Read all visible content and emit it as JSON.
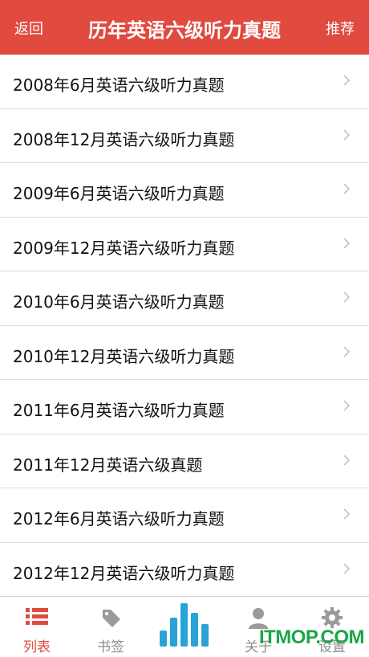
{
  "header": {
    "back_label": "返回",
    "title": "历年英语六级听力真题",
    "recommend_label": "推荐"
  },
  "list": {
    "items": [
      {
        "label": "2008年6月英语六级听力真题"
      },
      {
        "label": "2008年12月英语六级听力真题"
      },
      {
        "label": "2009年6月英语六级听力真题"
      },
      {
        "label": "2009年12月英语六级听力真题"
      },
      {
        "label": "2010年6月英语六级听力真题"
      },
      {
        "label": "2010年12月英语六级听力真题"
      },
      {
        "label": "2011年6月英语六级听力真题"
      },
      {
        "label": "2011年12月英语六级真题"
      },
      {
        "label": "2012年6月英语六级听力真题"
      },
      {
        "label": "2012年12月英语六级听力真题"
      }
    ]
  },
  "tabbar": {
    "tabs": [
      {
        "label": "列表",
        "icon": "list-icon",
        "active": true
      },
      {
        "label": "书签",
        "icon": "tag-icon",
        "active": false
      },
      {
        "label": "",
        "icon": "bar-chart-icon",
        "active": false
      },
      {
        "label": "关于",
        "icon": "person-icon",
        "active": false
      },
      {
        "label": "设置",
        "icon": "gear-icon",
        "active": false
      }
    ]
  },
  "watermark": {
    "text": "ITMOP.COM"
  },
  "colors": {
    "accent": "#e04a3f",
    "chart_blue": "#29a3d6",
    "tab_inactive": "#8e8e8e",
    "watermark": "#1aa64a"
  }
}
